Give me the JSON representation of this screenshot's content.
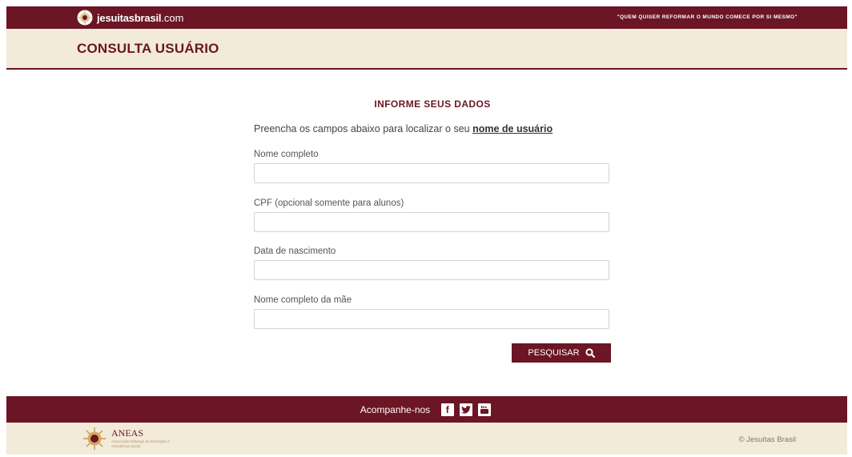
{
  "header": {
    "logo_text": "jesuitasbrasil",
    "logo_suffix": ".com",
    "motto": "\"QUEM QUISER REFORMAR O MUNDO COMECE POR SI MESMO\""
  },
  "page": {
    "title": "CONSULTA USUÁRIO"
  },
  "form": {
    "heading": "INFORME SEUS DADOS",
    "intro_text": "Preencha os campos abaixo para localizar o seu ",
    "intro_link": "nome de usuário",
    "fields": [
      {
        "label": "Nome completo",
        "value": "",
        "placeholder": ""
      },
      {
        "label": "CPF (opcional somente para alunos)",
        "value": "",
        "placeholder": ""
      },
      {
        "label": "Data de nascimento",
        "value": "",
        "placeholder": ""
      },
      {
        "label": "Nome completo da mãe",
        "value": "",
        "placeholder": ""
      }
    ],
    "submit_label": "PESQUISAR",
    "submit_icon": "search-icon"
  },
  "footer": {
    "follow_label": "Acompanhe-nos",
    "social": [
      {
        "name": "facebook-icon",
        "glyph": "f"
      },
      {
        "name": "twitter-icon",
        "glyph": ""
      },
      {
        "name": "youtube-icon",
        "glyph": ""
      }
    ],
    "partner_name": "ANEAS",
    "partner_tagline": "Associação Nóbrega de Educação e Assistência Social",
    "copyright": "© Jesuítas Brasil"
  },
  "colors": {
    "brand": "#6b1525",
    "cream": "#f2ebd9",
    "gold": "#b8926a"
  }
}
